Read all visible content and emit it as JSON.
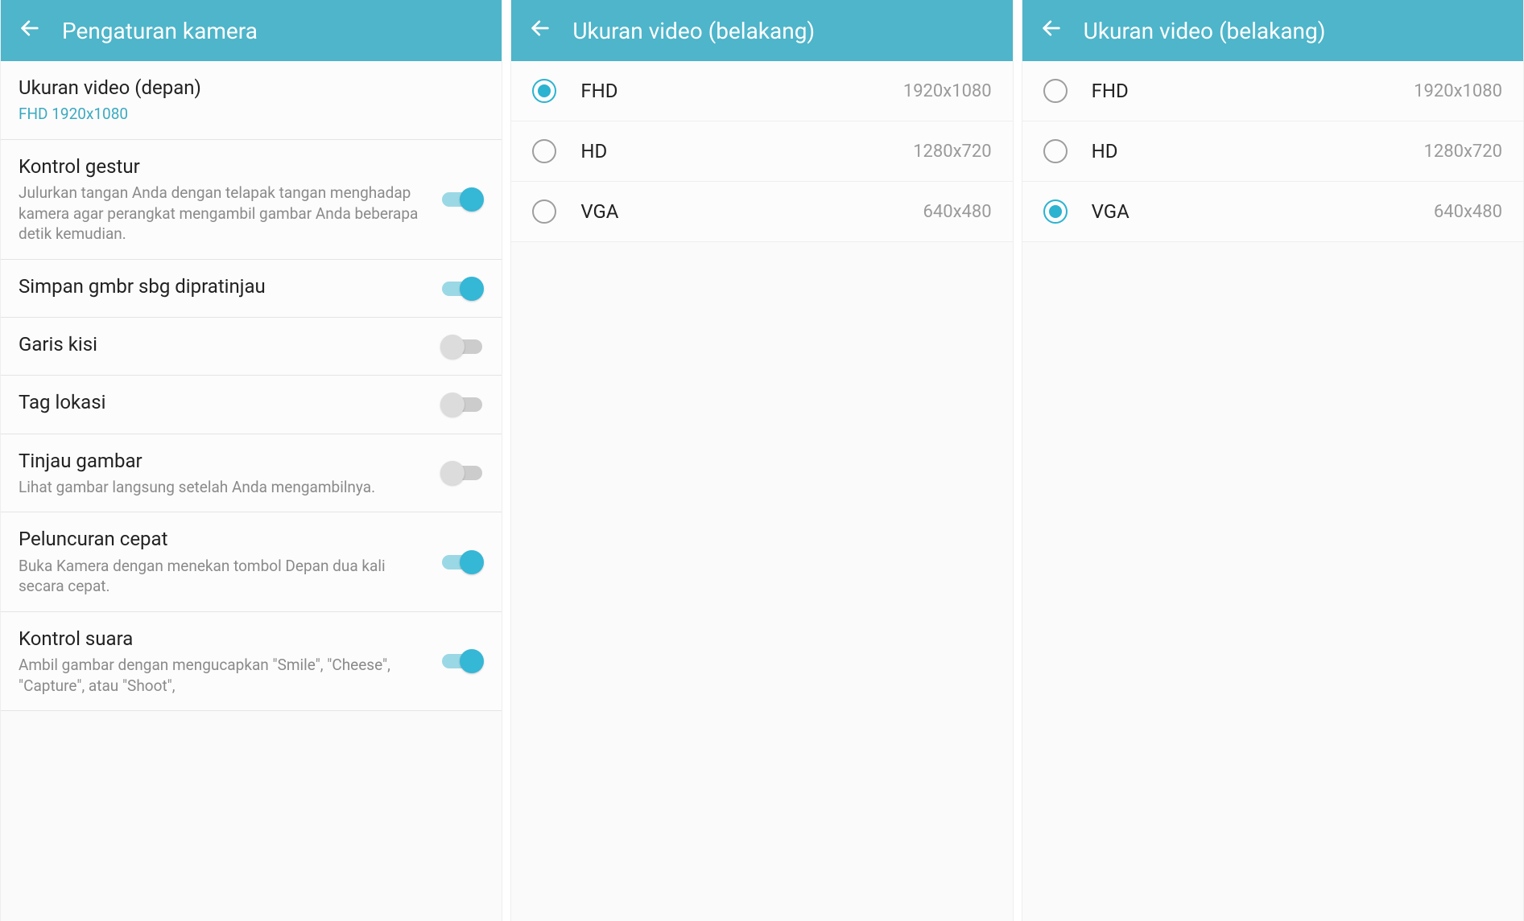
{
  "colors": {
    "accent": "#4eb5ca"
  },
  "panel1": {
    "title": "Pengaturan kamera",
    "items": [
      {
        "title": "Ukuran video (depan)",
        "sub": "FHD 1920x1080",
        "accent": true,
        "toggle": null,
        "on": false
      },
      {
        "title": "Kontrol gestur",
        "sub": "Julurkan tangan Anda dengan telapak tangan menghadap kamera agar perangkat mengambil gambar Anda beberapa detik kemudian.",
        "accent": false,
        "toggle": true,
        "on": true
      },
      {
        "title": "Simpan gmbr sbg dipratinjau",
        "sub": "",
        "accent": false,
        "toggle": true,
        "on": true
      },
      {
        "title": "Garis kisi",
        "sub": "",
        "accent": false,
        "toggle": true,
        "on": false
      },
      {
        "title": "Tag lokasi",
        "sub": "",
        "accent": false,
        "toggle": true,
        "on": false
      },
      {
        "title": "Tinjau gambar",
        "sub": "Lihat gambar langsung setelah Anda mengambilnya.",
        "accent": false,
        "toggle": true,
        "on": false
      },
      {
        "title": "Peluncuran cepat",
        "sub": "Buka Kamera dengan menekan tombol Depan dua kali secara cepat.",
        "accent": false,
        "toggle": true,
        "on": true
      },
      {
        "title": "Kontrol suara",
        "sub": "Ambil gambar dengan mengucapkan \"Smile\", \"Cheese\", \"Capture\", atau \"Shoot\",",
        "accent": false,
        "toggle": true,
        "on": true
      }
    ]
  },
  "panel2": {
    "title": "Ukuran video (belakang)",
    "options": [
      {
        "label": "FHD",
        "res": "1920x1080",
        "selected": true
      },
      {
        "label": "HD",
        "res": "1280x720",
        "selected": false
      },
      {
        "label": "VGA",
        "res": "640x480",
        "selected": false
      }
    ]
  },
  "panel3": {
    "title": "Ukuran video (belakang)",
    "options": [
      {
        "label": "FHD",
        "res": "1920x1080",
        "selected": false
      },
      {
        "label": "HD",
        "res": "1280x720",
        "selected": false
      },
      {
        "label": "VGA",
        "res": "640x480",
        "selected": true
      }
    ]
  }
}
